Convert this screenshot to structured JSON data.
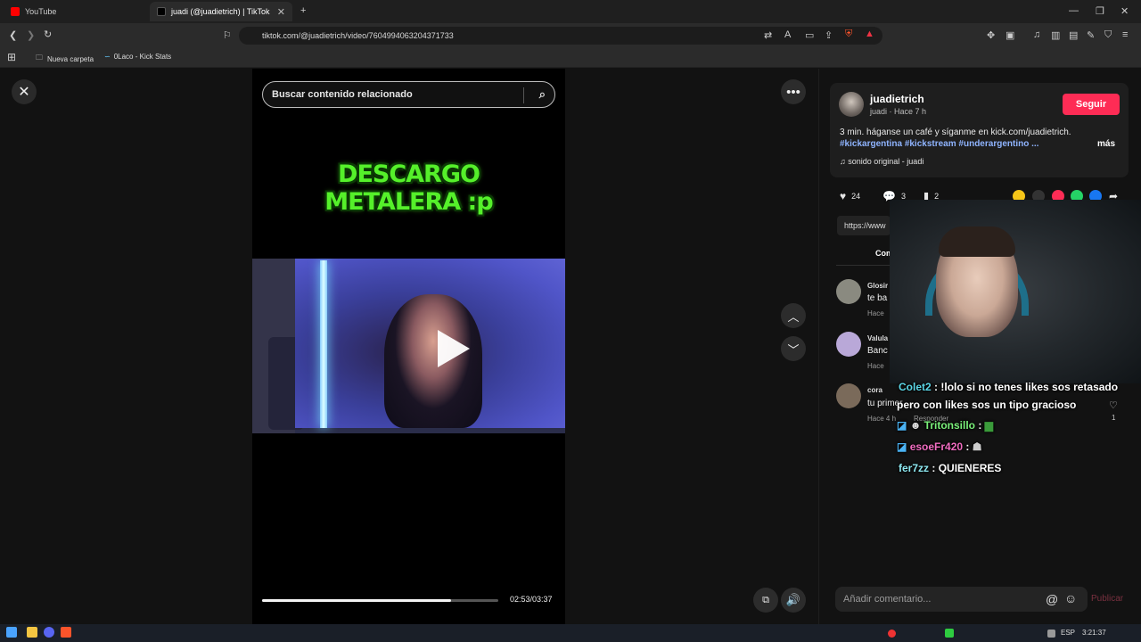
{
  "browser": {
    "tabs": [
      {
        "title": "YouTube",
        "active": false
      },
      {
        "title": "juadi (@juadietrich) | TikTok",
        "active": true
      }
    ],
    "url": "tiktok.com/@juadietrich/video/7604994063204371733",
    "bookmarks": [
      "Nueva carpeta",
      "0Laco - Kick Stats"
    ]
  },
  "video": {
    "search_placeholder": "Buscar contenido relacionado",
    "overlay_line1": "DESCARGO",
    "overlay_line2": "METALERA :p",
    "progress_fraction": 0.8,
    "time": "02:53/03:37"
  },
  "author": {
    "name": "juadietrich",
    "sub": "juadi · Hace 7 h",
    "follow_label": "Seguir",
    "description": "3 min. háganse un café y síganme en kick.com/juadietrich.",
    "tags": "#kickargentina #kickstream #underargentino ...",
    "more_label": "más",
    "sound": "sonido original - juadi"
  },
  "stats": {
    "likes": "24",
    "comments": "3",
    "saves": "2"
  },
  "url_box": "https://www",
  "comments_tab": "Com",
  "comments": [
    {
      "name": "Glosir",
      "text": "te ba",
      "meta": "Hace"
    },
    {
      "name": "Valula",
      "text": "Banc",
      "meta": "Hace"
    },
    {
      "name": "cora",
      "text": "tu primer",
      "meta": "Hace 4 h",
      "reply": "Responder",
      "likes": "1"
    }
  ],
  "chat": [
    {
      "user": "Colet2",
      "text": ": !lolo si no tenes likes sos retasado"
    },
    {
      "user": "",
      "text": "pero con likes sos un tipo gracioso"
    },
    {
      "user": "Tritonsillo",
      "text": ":"
    },
    {
      "user": "esoeFr420",
      "text": ":"
    },
    {
      "user": "fer7zz",
      "text": ": QUIENERES"
    }
  ],
  "comment_input": {
    "placeholder": "Añadir comentario...",
    "publish_label": "Publicar"
  },
  "taskbar": {
    "lang": "ESP",
    "clock": "3:21:37"
  },
  "colors": {
    "accent": "#fe2c55",
    "tag": "#8fb4ff",
    "overlay": "#55f02a"
  }
}
